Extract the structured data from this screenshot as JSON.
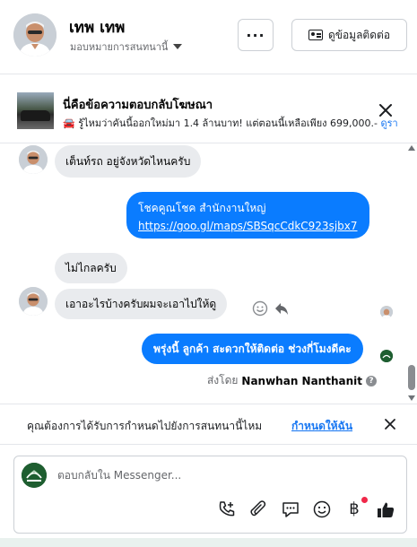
{
  "header": {
    "contact_name": "เทพ เทพ",
    "assign_label": "มอบหมายการสนทนานี้",
    "more_label": "···",
    "view_contact_label": "ดูข้อมูลติดต่อ"
  },
  "ad_reply": {
    "title": "นี่คือข้อความตอบกลับโฆษณา",
    "car_emoji": "🚘",
    "subtitle": "รู้ไหมว่าคันนี้ออกใหม่มา 1.4 ล้านบาท! แต่ตอนนี้เหลือเพียง 699,000.-",
    "more_link": "ดูรา"
  },
  "messages": [
    {
      "direction": "incoming",
      "text": "เต็นท์รถ อยู่จังหวัดไหนครับ"
    },
    {
      "direction": "outgoing",
      "text": "โชคคูณโชค สำนักงานใหญ่",
      "link": "https://goo.gl/maps/SBSqcCdkC923sjbx7"
    },
    {
      "direction": "incoming",
      "text": "ไม่ไกลครับ"
    },
    {
      "direction": "incoming",
      "text": "เอาอะไรบ้างครับผมจะเอาไปให้ดู"
    },
    {
      "direction": "outgoing",
      "text": "พรุ่งนี้ ลูกค้า สะดวกให้ติดต่อ ช่วงกี่โมงดีคะ"
    }
  ],
  "sent_by": {
    "prefix": "ส่งโดย",
    "name": "Nanwhan Nanthanit",
    "help_glyph": "?"
  },
  "assign_prompt": {
    "question": "คุณต้องการได้รับการกำหนดไปยังการสนทนานี้ไหม",
    "action": "กำหนดให้ฉัน"
  },
  "composer": {
    "placeholder": "ตอบกลับใน Messenger...",
    "baht_glyph": "฿"
  },
  "icons": [
    "caret-down-icon",
    "id-card-icon",
    "close-icon",
    "smiley-icon",
    "reply-icon",
    "help-icon",
    "phone-plus-icon",
    "paperclip-icon",
    "quick-reply-icon",
    "emoji-icon",
    "baht-icon",
    "thumbs-up-icon"
  ],
  "colors": {
    "outgoing_bubble": "#0a7cff",
    "incoming_bubble": "#e9ebee",
    "link": "#1877f2",
    "notification_dot": "#f02849",
    "thumbs_up": "#1c1e21"
  }
}
